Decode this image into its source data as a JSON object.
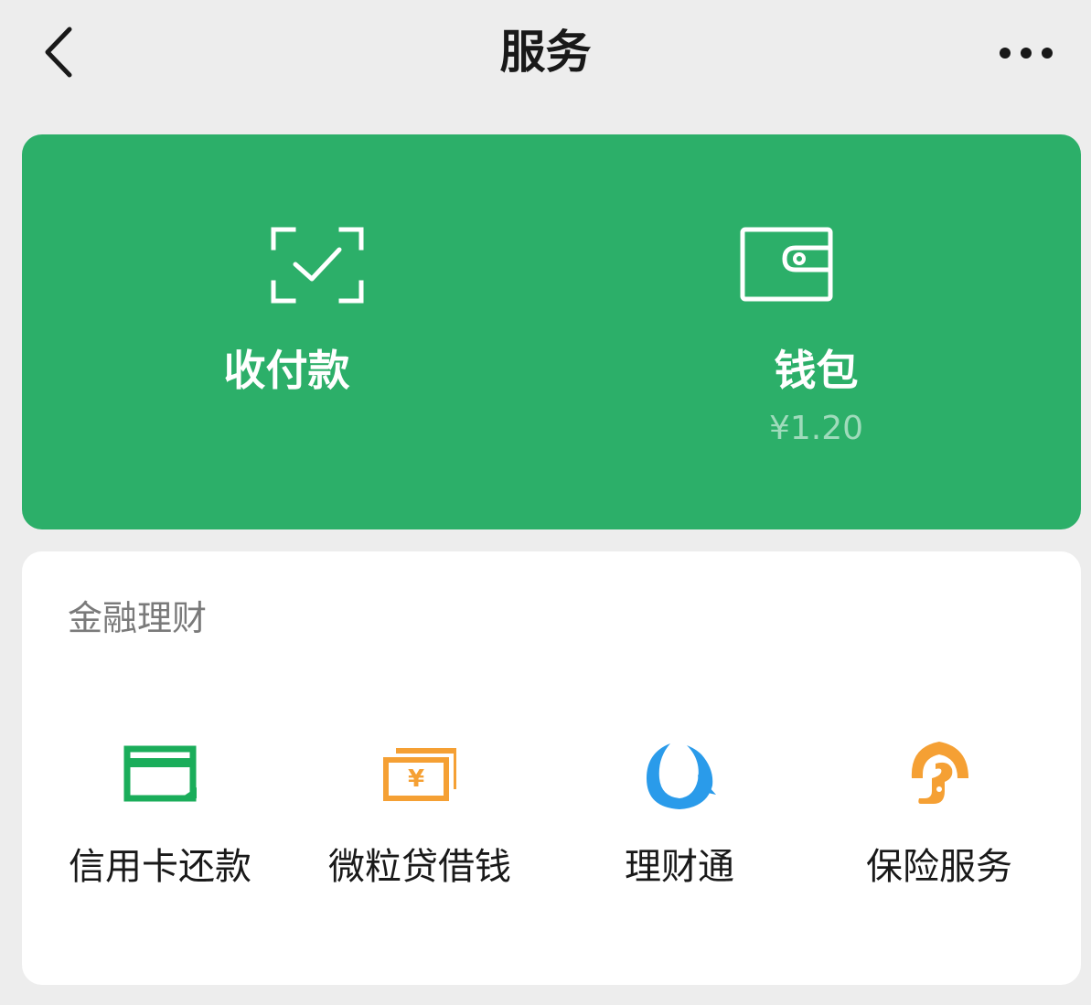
{
  "header": {
    "title": "服务",
    "back_icon": "chevron-left-icon",
    "more_icon": "more-dots-icon"
  },
  "wallet_card": {
    "background": "#2caf69",
    "items": [
      {
        "label": "收付款",
        "icon": "scan-check-icon"
      },
      {
        "label": "钱包",
        "icon": "wallet-icon",
        "balance": "¥1.20"
      }
    ]
  },
  "finance_section": {
    "title": "金融理财",
    "items": [
      {
        "label": "信用卡还款",
        "icon": "credit-card-icon",
        "color": "#1aad5a"
      },
      {
        "label": "微粒贷借钱",
        "icon": "yuan-bill-icon",
        "color": "#f5a034"
      },
      {
        "label": "理财通",
        "icon": "licaitong-icon",
        "color": "#2a9bea"
      },
      {
        "label": "保险服务",
        "icon": "insurance-umbrella-icon",
        "color": "#f5a034"
      }
    ]
  }
}
